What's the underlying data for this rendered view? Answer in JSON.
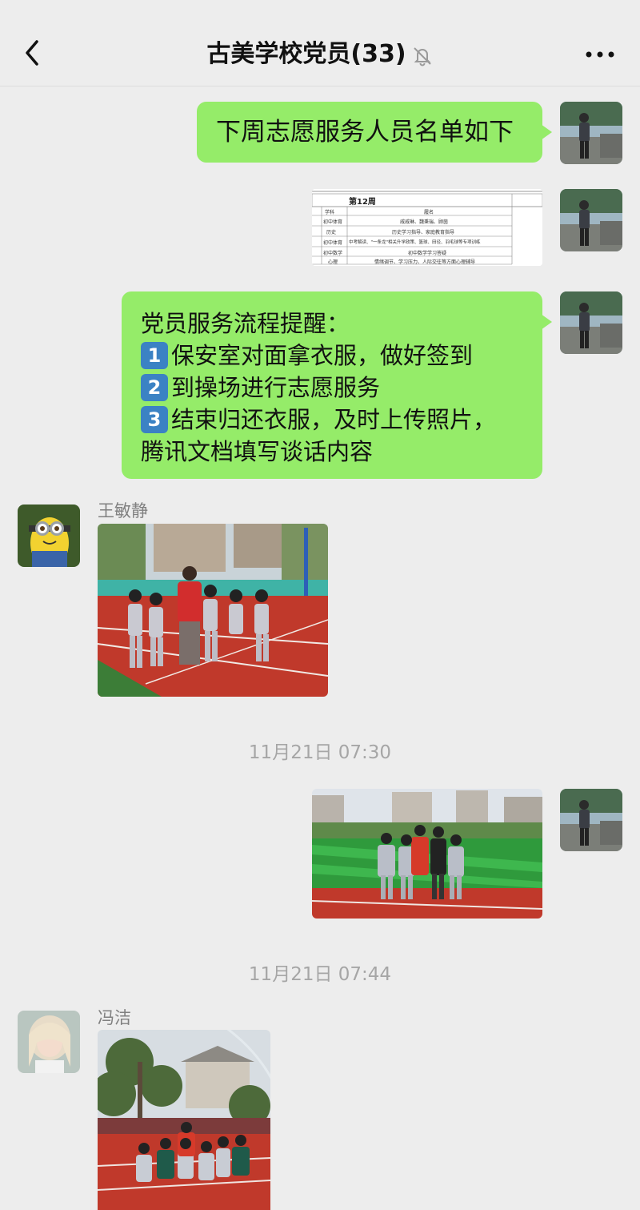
{
  "header": {
    "title": "古美学校党员(33)",
    "back_icon": "chevron-left-icon",
    "mute_icon": "bell-off-icon",
    "more_icon": "more-dots-icon"
  },
  "messages": {
    "m1": {
      "text": "下周志愿服务人员名单如下"
    },
    "m2": {
      "title": "第12周",
      "col_subject": "学科",
      "col_names": "履名",
      "rows": [
        [
          "初中体育",
          "戚戚琳、魏秉瑞、顾茵"
        ],
        [
          "历史",
          "历史学习指导、家庭教育指导"
        ],
        [
          "初中体育",
          "中考解读、\"一条龙\"相关升学政策、篮球、田径、羽毛球等专项训练"
        ],
        [
          "初中数学",
          "初中数学学习答疑"
        ],
        [
          "心理",
          "情绪调节、学习压力、人际交往等方面心理辅导"
        ]
      ]
    },
    "m3": {
      "line1": "党员服务流程提醒：",
      "s1_num": "1",
      "s1_text": "保安室对面拿衣服，做好签到",
      "s2_num": "2",
      "s2_text": "到操场进行志愿服务",
      "s3_num": "3",
      "s3_text": "结束归还衣服，及时上传照片，",
      "line5": "腾讯文档填写谈话内容"
    },
    "m4": {
      "sender": "王敏静"
    },
    "t1": {
      "time": "11月21日 07:30"
    },
    "t2": {
      "time": "11月21日 07:44"
    },
    "m6": {
      "sender": "冯洁"
    }
  },
  "colors": {
    "bubble_green": "#95ec69",
    "background": "#ededed",
    "number_badge": "#3b82c4"
  }
}
